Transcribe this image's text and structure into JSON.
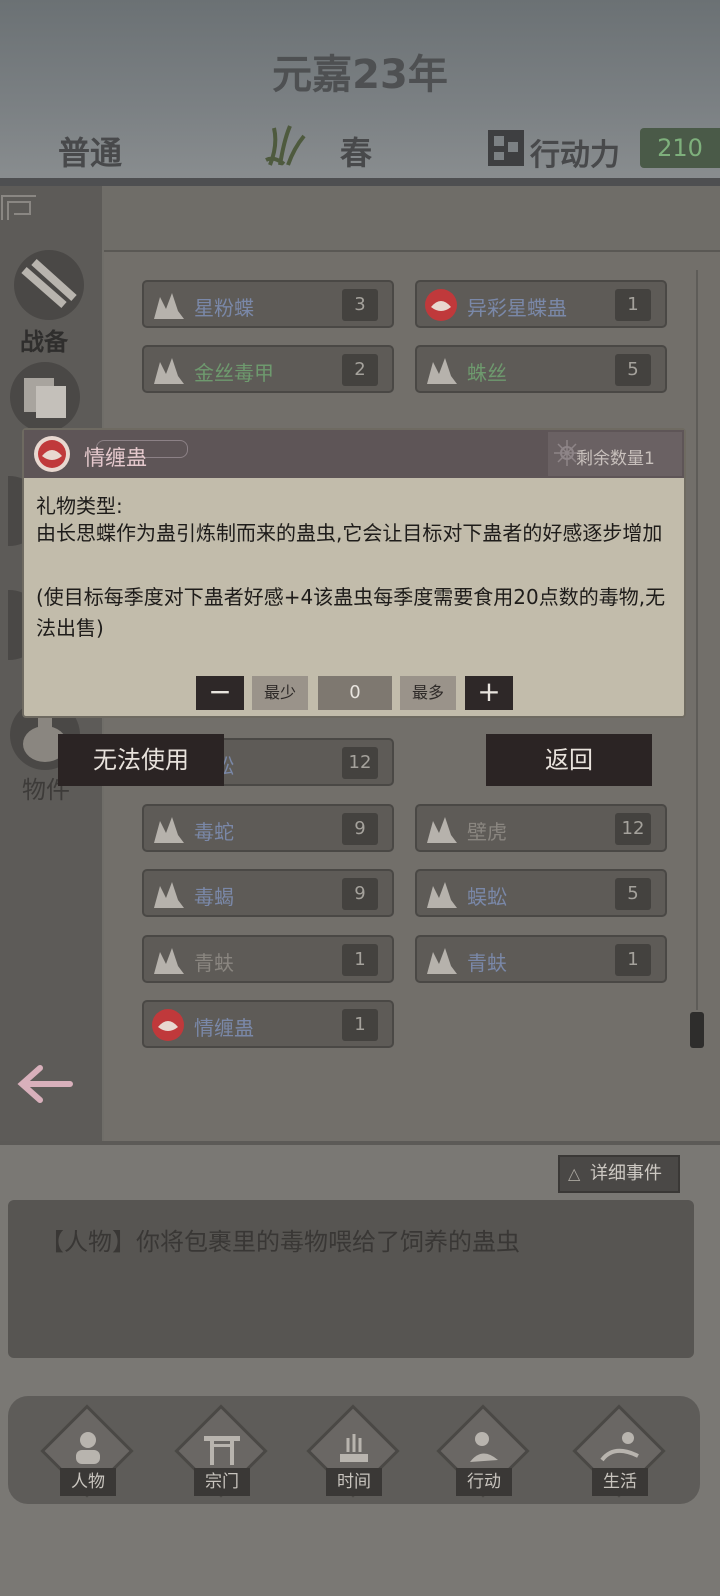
{
  "header": {
    "year": "元嘉23年",
    "mode": "普通",
    "season": "春",
    "action_points_label": "行动力",
    "action_points_value": "210"
  },
  "sidebar": {
    "label_combat": "战备",
    "label_items": "物件"
  },
  "items": [
    {
      "name": "星粉蝶",
      "count": "3",
      "color": "#7a88a8",
      "icon": "leaf"
    },
    {
      "name": "异彩星蝶蛊",
      "count": "1",
      "color": "#7a88a8",
      "icon": "gu-red"
    },
    {
      "name": "金丝毒甲",
      "count": "2",
      "color": "#6e9a6e",
      "icon": "leaf"
    },
    {
      "name": "蛛丝",
      "count": "5",
      "color": "#6e9a6e",
      "icon": "leaf"
    },
    {
      "name": "蜈蚣",
      "count": "12",
      "color": "#7a88a8",
      "icon": "leaf"
    },
    {
      "name": "毒蛇",
      "count": "9",
      "color": "#7a88a8",
      "icon": "leaf"
    },
    {
      "name": "壁虎",
      "count": "12",
      "color": "#8a8680",
      "icon": "leaf"
    },
    {
      "name": "毒蝎",
      "count": "9",
      "color": "#7a88a8",
      "icon": "leaf"
    },
    {
      "name": "蜈蚣",
      "count": "5",
      "color": "#7a88a8",
      "icon": "leaf"
    },
    {
      "name": "青蚨",
      "count": "1",
      "color": "#8a8680",
      "icon": "leaf"
    },
    {
      "name": "青蚨",
      "count": "1",
      "color": "#7a88a8",
      "icon": "leaf"
    },
    {
      "name": "情缠蛊",
      "count": "1",
      "color": "#7a88a8",
      "icon": "gu-red"
    }
  ],
  "popup": {
    "title": "情缠蛊",
    "remaining": "剩余数量1",
    "type_label": "礼物类型:",
    "description": "由长思蝶作为蛊引炼制而来的蛊虫,它会让目标对下蛊者的好感逐步增加",
    "note": "(使目标每季度对下蛊者好感+4该蛊虫每季度需要食用20点数的毒物,无法出售)",
    "minus": "−",
    "min_label": "最少",
    "quantity": "0",
    "max_label": "最多",
    "plus": "+",
    "cannot_use": "无法使用",
    "return": "返回"
  },
  "events": {
    "detail_button": "详细事件",
    "text": "【人物】你将包裹里的毒物喂给了饲养的蛊虫"
  },
  "nav": [
    {
      "label": "人物"
    },
    {
      "label": "宗门"
    },
    {
      "label": "时间"
    },
    {
      "label": "行动"
    },
    {
      "label": "生活"
    }
  ],
  "colors": {
    "accent_green": "#7eb07c",
    "popup_bg": "#c2bcab",
    "dark_button": "#2b2424"
  }
}
